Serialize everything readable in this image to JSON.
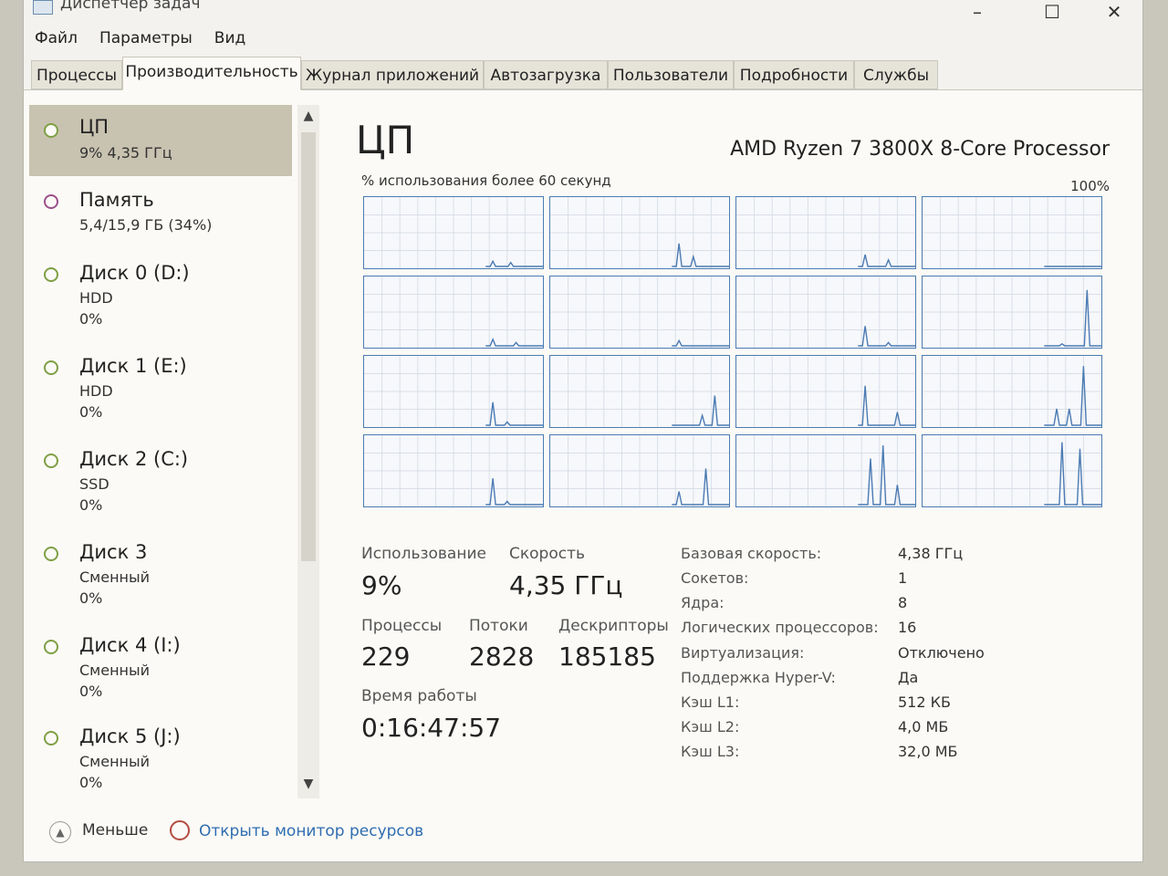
{
  "window": {
    "title": "Диспетчер задач"
  },
  "menu": [
    "Файл",
    "Параметры",
    "Вид"
  ],
  "tabs": [
    "Процессы",
    "Производительность",
    "Журнал приложений",
    "Автозагрузка",
    "Пользователи",
    "Подробности",
    "Службы"
  ],
  "active_tab": "Производительность",
  "sidebar": {
    "items": [
      {
        "title": "ЦП",
        "line1": "9% 4,35 ГГц",
        "line2": "",
        "color": "#7f9f44",
        "selected": true
      },
      {
        "title": "Память",
        "line1": "5,4/15,9 ГБ (34%)",
        "line2": "",
        "color": "#9b4f8a",
        "selected": false
      },
      {
        "title": "Диск 0 (D:)",
        "line1": "HDD",
        "line2": "0%",
        "color": "#7f9f44",
        "selected": false
      },
      {
        "title": "Диск 1 (E:)",
        "line1": "HDD",
        "line2": "0%",
        "color": "#7f9f44",
        "selected": false
      },
      {
        "title": "Диск 2 (C:)",
        "line1": "SSD",
        "line2": "0%",
        "color": "#7f9f44",
        "selected": false
      },
      {
        "title": "Диск 3",
        "line1": "Сменный",
        "line2": "0%",
        "color": "#7f9f44",
        "selected": false
      },
      {
        "title": "Диск 4 (I:)",
        "line1": "Сменный",
        "line2": "0%",
        "color": "#7f9f44",
        "selected": false
      },
      {
        "title": "Диск 5 (J:)",
        "line1": "Сменный",
        "line2": "0%",
        "color": "#7f9f44",
        "selected": false
      }
    ]
  },
  "main": {
    "title": "ЦП",
    "model": "AMD Ryzen 7 3800X 8-Core Processor",
    "graph_caption": "% использования более 60 секунд",
    "graph_max": "100%",
    "stats": {
      "usage_label": "Использование",
      "usage_value": "9%",
      "speed_label": "Скорость",
      "speed_value": "4,35 ГГц",
      "processes_label": "Процессы",
      "processes_value": "229",
      "threads_label": "Потоки",
      "threads_value": "2828",
      "handles_label": "Дескрипторы",
      "handles_value": "185185",
      "uptime_label": "Время работы",
      "uptime_value": "0:16:47:57"
    },
    "info": [
      {
        "label": "Базовая скорость:",
        "value": "4,38 ГГц"
      },
      {
        "label": "Сокетов:",
        "value": "1"
      },
      {
        "label": "Ядра:",
        "value": "8"
      },
      {
        "label": "Логических процессоров:",
        "value": "16"
      },
      {
        "label": "Виртуализация:",
        "value": "Отключено"
      },
      {
        "label": "Поддержка Hyper-V:",
        "value": "Да"
      },
      {
        "label": "Кэш L1:",
        "value": "512 КБ"
      },
      {
        "label": "Кэш L2:",
        "value": "4,0 МБ"
      },
      {
        "label": "Кэш L3:",
        "value": "32,0 МБ"
      }
    ]
  },
  "footer": {
    "less_label": "Меньше",
    "monitor_link": "Открыть монитор ресурсов"
  },
  "colors": {
    "graph_line": "#4b7bb3",
    "graph_grid": "#d9dfe8",
    "link": "#2f6db0",
    "selected_bg": "#c8c3b0"
  }
}
